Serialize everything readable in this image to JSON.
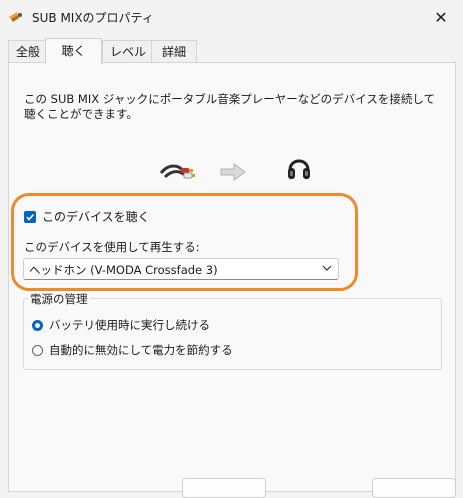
{
  "window": {
    "title": "SUB MIXのプロパティ",
    "close_glyph": "✕"
  },
  "tabs": [
    {
      "label": "全般",
      "active": false
    },
    {
      "label": "聴く",
      "active": true
    },
    {
      "label": "レベル",
      "active": false
    },
    {
      "label": "詳細",
      "active": false
    }
  ],
  "listen": {
    "description": "この SUB MIX ジャックにポータブル音楽プレーヤーなどのデバイスを接続して聴くことができます。",
    "icons": [
      "audio-cable-icon",
      "arrow-right-icon",
      "headphones-icon"
    ],
    "checkbox_label": "このデバイスを聴く",
    "checkbox_checked": true,
    "playback_label": "このデバイスを使用して再生する:",
    "playback_device": "ヘッドホン (V-MODA Crossfade 3)"
  },
  "power": {
    "legend": "電源の管理",
    "options": [
      {
        "label": "バッテリ使用時に実行し続ける",
        "selected": true
      },
      {
        "label": "自動的に無効にして電力を節約する",
        "selected": false
      }
    ]
  },
  "colors": {
    "accent": "#0067c0",
    "highlight": "#f0892a"
  }
}
